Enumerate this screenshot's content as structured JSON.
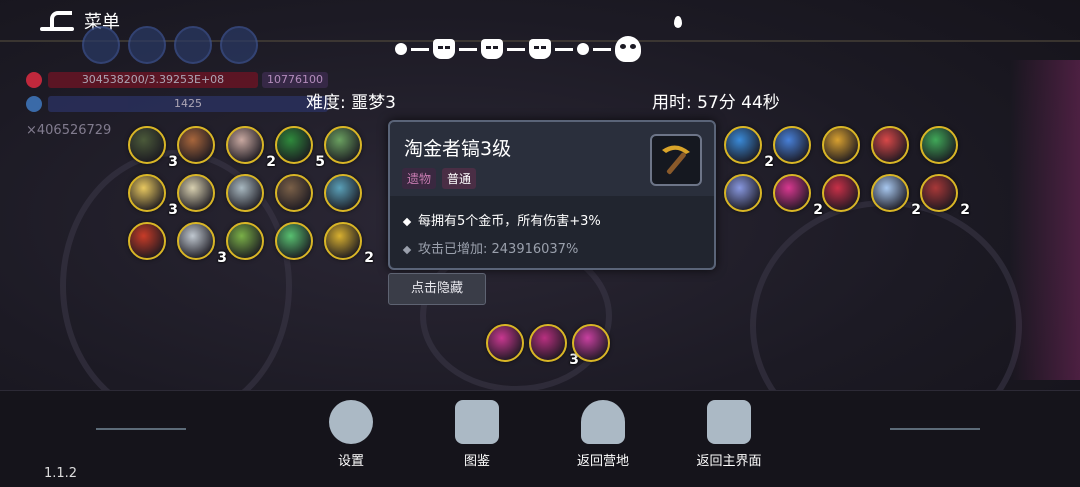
{
  "menu": {
    "label": "菜单"
  },
  "hud": {
    "hp_text": "304538200/3.39253E+08",
    "hp_max_text": "10776100",
    "mp_text": "1425",
    "coins_text": "×406526729"
  },
  "progress": {
    "current_stage": 6,
    "total_stages": 7
  },
  "info": {
    "difficulty": "难度: 噩梦3",
    "time": "用时: 57分 44秒"
  },
  "inventory": {
    "left_rows": [
      [
        {
          "icon": "alien-mask-icon",
          "color": "#4b5a3a",
          "count": "3"
        },
        {
          "icon": "cocoon-icon",
          "color": "#a8663c",
          "count": ""
        },
        {
          "icon": "bone-icon",
          "color": "#c8a8a0",
          "count": "2"
        },
        {
          "icon": "moss-icon",
          "color": "#2f8a3c",
          "count": "5"
        },
        {
          "icon": "fist-icon",
          "color": "#6aa060",
          "count": ""
        }
      ],
      [
        {
          "icon": "tooth-icon",
          "color": "#e8c860",
          "count": "3"
        },
        {
          "icon": "fairy-wing-icon",
          "color": "#d8d0b0",
          "count": ""
        },
        {
          "icon": "compass-icon",
          "color": "#a8b8c0",
          "count": ""
        },
        {
          "icon": "hedgehog-icon",
          "color": "#7a6048",
          "count": ""
        },
        {
          "icon": "twin-mask-icon",
          "color": "#5aa0b8",
          "count": ""
        }
      ],
      [
        {
          "icon": "crate-icon",
          "color": "#c83c28",
          "count": ""
        },
        {
          "icon": "sword-icon",
          "color": "#c0c8d0",
          "count": "3"
        },
        {
          "icon": "seed-icon",
          "color": "#7ab048",
          "count": ""
        },
        {
          "icon": "leaf-icon",
          "color": "#58c070",
          "count": ""
        },
        {
          "icon": "claw-icon",
          "color": "#d8b030",
          "count": "2"
        }
      ]
    ],
    "right_rows": [
      [
        {
          "icon": "ring-icon",
          "color": "#3a8ad8",
          "count": "2"
        },
        {
          "icon": "crown-orb-icon",
          "color": "#4880d8",
          "count": ""
        },
        {
          "icon": "golden-key-icon",
          "color": "#d8a030",
          "count": ""
        },
        {
          "icon": "potion-icon",
          "color": "#d84848",
          "count": ""
        },
        {
          "icon": "turtle-shell-icon",
          "color": "#40a858",
          "count": ""
        }
      ],
      [
        {
          "icon": "crystal-icon",
          "color": "#8898e0",
          "count": ""
        },
        {
          "icon": "pink-eye-icon",
          "color": "#d83890",
          "count": "2"
        },
        {
          "icon": "red-eye-icon",
          "color": "#c83048",
          "count": ""
        },
        {
          "icon": "lotus-icon",
          "color": "#a8c8f0",
          "count": "2"
        },
        {
          "icon": "cape-icon",
          "color": "#a83838",
          "count": "2"
        }
      ]
    ],
    "skills": [
      {
        "icon": "pink-rune-icon",
        "color": "#c83890",
        "count": ""
      },
      {
        "icon": "pink-gear-icon",
        "color": "#b83080",
        "count": "3"
      },
      {
        "icon": "pink-spiral-icon",
        "color": "#c840a0",
        "count": ""
      }
    ]
  },
  "tooltip": {
    "title": "淘金者镐3级",
    "tag_type": "遗物",
    "tag_rarity": "普通",
    "effect": "每拥有5个金币，所有伤害+3%",
    "stat": "攻击已增加: 243916037%",
    "icon": "pickaxe-icon",
    "accent": "#d9b626"
  },
  "hide_button": {
    "label": "点击隐藏"
  },
  "nav": {
    "settings": "设置",
    "codex": "图鉴",
    "camp": "返回营地",
    "main": "返回主界面"
  },
  "version": "1.1.2"
}
